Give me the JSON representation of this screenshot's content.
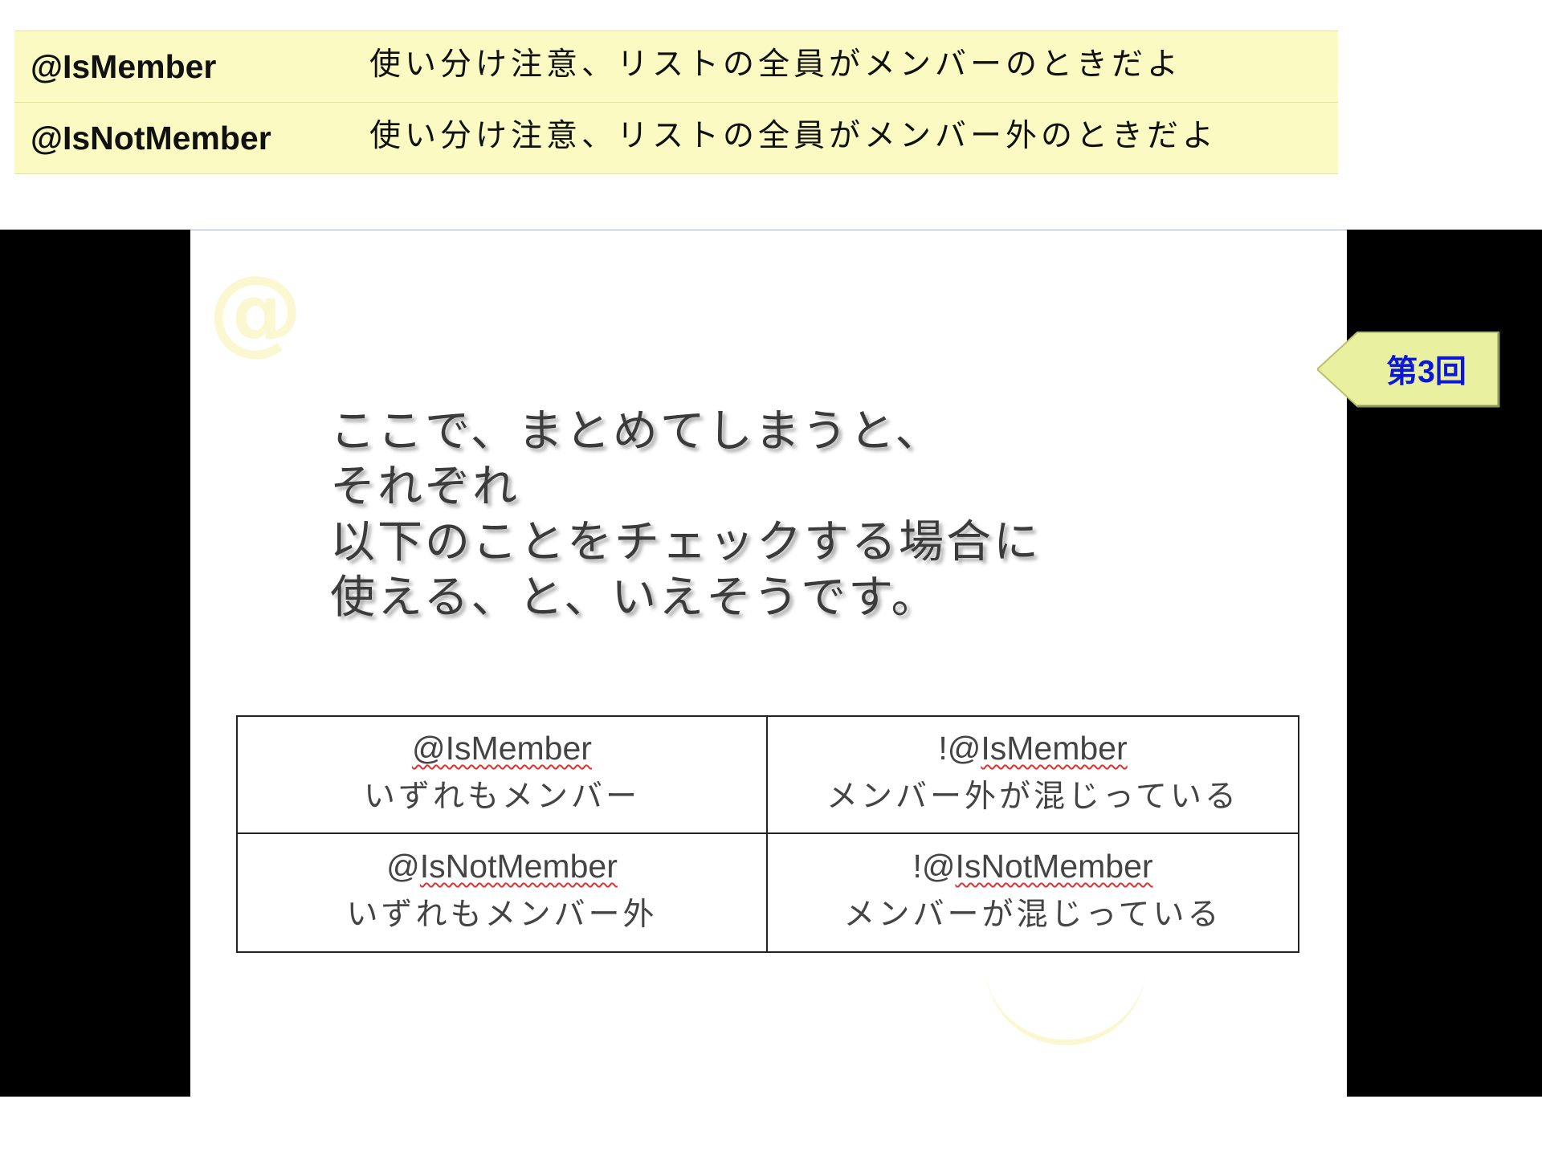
{
  "definitions": [
    {
      "term": "@IsMember",
      "description": "使い分け注意、リストの全員がメンバーのときだよ"
    },
    {
      "term": "@IsNotMember",
      "description": "使い分け注意、リストの全員がメンバー外のときだよ"
    }
  ],
  "slide": {
    "at_symbol": "@",
    "lines": [
      "ここで、まとめてしまうと、",
      "それぞれ",
      "以下のことをチェックする場合に",
      "使える、と、いえそうです。"
    ],
    "table": [
      {
        "code": "@IsMember",
        "prefix": "",
        "meaning": "いずれもメンバー"
      },
      {
        "code": "IsMember",
        "prefix": "!@",
        "meaning": "メンバー外が混じっている"
      },
      {
        "code": "IsNotMember",
        "prefix": "@",
        "meaning": "いずれもメンバー外"
      },
      {
        "code": "IsNotMember",
        "prefix": "!@",
        "meaning": "メンバーが混じっている"
      }
    ]
  },
  "badge": {
    "label": "第3回",
    "color": "#0b18d8",
    "fill": "#e9f0a0"
  }
}
